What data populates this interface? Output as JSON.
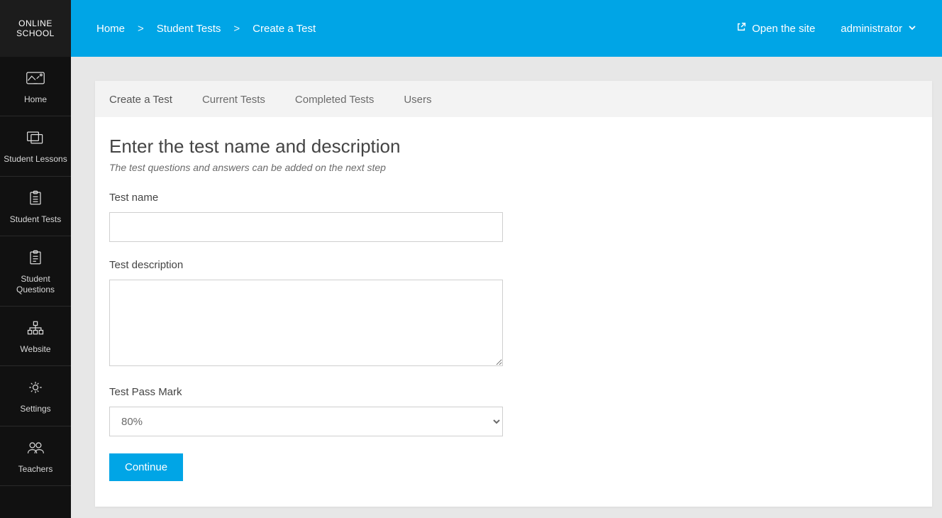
{
  "brand": {
    "line1": "ONLINE",
    "line2": "SCHOOL"
  },
  "sidebar": {
    "items": [
      {
        "label": "Home"
      },
      {
        "label": "Student Lessons"
      },
      {
        "label": "Student Tests"
      },
      {
        "label": "Student Questions"
      },
      {
        "label": "Website"
      },
      {
        "label": "Settings"
      },
      {
        "label": "Teachers"
      }
    ]
  },
  "topbar": {
    "breadcrumb": [
      {
        "label": "Home"
      },
      {
        "label": "Student Tests"
      },
      {
        "label": "Create a Test"
      }
    ],
    "sep": ">",
    "open_site_label": "Open the site",
    "user_name": "administrator"
  },
  "tabs": [
    {
      "label": "Create a Test"
    },
    {
      "label": "Current Tests"
    },
    {
      "label": "Completed Tests"
    },
    {
      "label": "Users"
    }
  ],
  "form": {
    "title": "Enter the test name and description",
    "subtitle": "The test questions and answers can be added on the next step",
    "test_name_label": "Test name",
    "test_name_value": "",
    "test_desc_label": "Test description",
    "test_desc_value": "",
    "pass_mark_label": "Test Pass Mark",
    "pass_mark_value": "80%",
    "continue_label": "Continue"
  }
}
